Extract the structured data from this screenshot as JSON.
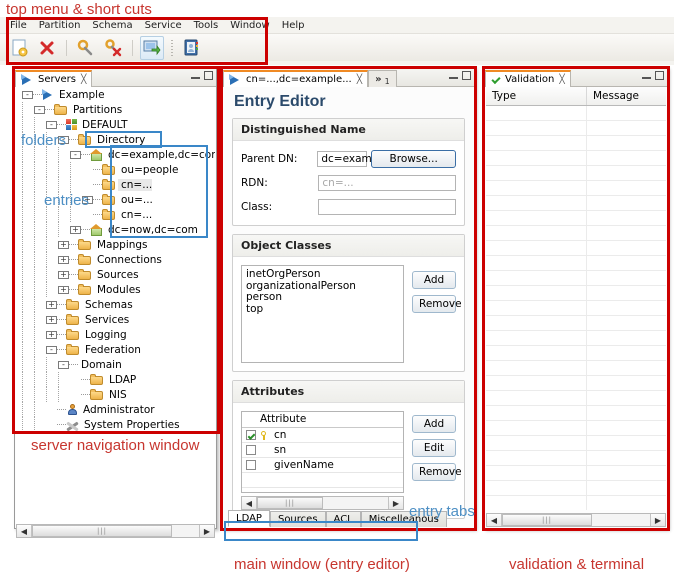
{
  "annotations": {
    "top": "top menu & short cuts",
    "folders": "folders",
    "entries": "entries",
    "server_nav": "server navigation window",
    "entry_tabs": "entry tabs",
    "main_window": "main window (entry editor)",
    "validation_terminal": "validation & terminal",
    "red": "#cc0000",
    "blue": "#3a87c8"
  },
  "menu": {
    "items": [
      "File",
      "Partition",
      "Schema",
      "Service",
      "Tools",
      "Window",
      "Help"
    ]
  },
  "toolbar": {
    "buttons": [
      {
        "name": "new-partition-icon",
        "title": "New"
      },
      {
        "name": "delete-icon",
        "title": "Delete"
      },
      {
        "name": "connect-icon",
        "title": "Connect"
      },
      {
        "name": "disconnect-icon",
        "title": "Disconnect"
      },
      {
        "name": "open-console-icon",
        "title": "Console"
      },
      {
        "name": "address-book-icon",
        "title": "Browse"
      }
    ]
  },
  "servers_view": {
    "tab_label": "Servers",
    "tree": [
      {
        "label": "Example",
        "depth": 0,
        "twist": "-",
        "icon": "server-icon"
      },
      {
        "label": "Partitions",
        "depth": 1,
        "twist": "-",
        "icon": "folder-icon"
      },
      {
        "label": "DEFAULT",
        "depth": 2,
        "twist": "-",
        "icon": "grid-icon"
      },
      {
        "label": "Directory",
        "depth": 3,
        "twist": "-",
        "icon": "folder-icon"
      },
      {
        "label": "dc=example,dc=com",
        "depth": 4,
        "twist": "-",
        "icon": "home-icon"
      },
      {
        "label": "ou=people",
        "depth": 5,
        "twist": "",
        "icon": "folder-icon"
      },
      {
        "label": "cn=...",
        "depth": 5,
        "twist": "",
        "icon": "folder-icon",
        "selected": true
      },
      {
        "label": "ou=...",
        "depth": 5,
        "twist": "+",
        "icon": "folder-icon"
      },
      {
        "label": "cn=...",
        "depth": 5,
        "twist": "",
        "icon": "folder-icon"
      },
      {
        "label": "dc=now,dc=com",
        "depth": 4,
        "twist": "+",
        "icon": "home-icon"
      },
      {
        "label": "Mappings",
        "depth": 3,
        "twist": "+",
        "icon": "folder-icon"
      },
      {
        "label": "Connections",
        "depth": 3,
        "twist": "+",
        "icon": "folder-icon"
      },
      {
        "label": "Sources",
        "depth": 3,
        "twist": "+",
        "icon": "folder-icon"
      },
      {
        "label": "Modules",
        "depth": 3,
        "twist": "+",
        "icon": "folder-icon"
      },
      {
        "label": "Schemas",
        "depth": 2,
        "twist": "+",
        "icon": "folder-icon"
      },
      {
        "label": "Services",
        "depth": 2,
        "twist": "+",
        "icon": "folder-icon"
      },
      {
        "label": "Logging",
        "depth": 2,
        "twist": "+",
        "icon": "folder-icon"
      },
      {
        "label": "Federation",
        "depth": 2,
        "twist": "-",
        "icon": "folder-icon"
      },
      {
        "label": "Domain",
        "depth": 3,
        "twist": "-",
        "icon": ""
      },
      {
        "label": "LDAP",
        "depth": 4,
        "twist": "",
        "icon": "folder-icon"
      },
      {
        "label": "NIS",
        "depth": 4,
        "twist": "",
        "icon": "folder-icon"
      },
      {
        "label": "Administrator",
        "depth": 2,
        "twist": "",
        "icon": "user-icon"
      },
      {
        "label": "System Properties",
        "depth": 2,
        "twist": "",
        "icon": "tools-icon"
      }
    ]
  },
  "editor_view": {
    "tab_label": "cn=...,dc=example...",
    "overflow_tab": "»",
    "overflow_count": "1",
    "title": "Entry Editor",
    "dn_section": {
      "header": "Distinguished Name",
      "parent_dn_label": "Parent DN:",
      "parent_dn_value": "dc=exam",
      "browse_label": "Browse...",
      "rdn_label": "RDN:",
      "rdn_placeholder": "cn=...",
      "class_label": "Class:",
      "class_value": ""
    },
    "object_classes": {
      "header": "Object Classes",
      "items": [
        "inetOrgPerson",
        "organizationalPerson",
        "person",
        "top"
      ],
      "add_label": "Add",
      "remove_label": "Remove"
    },
    "attributes": {
      "header": "Attributes",
      "column": "Attribute",
      "rows": [
        {
          "checked": true,
          "key": true,
          "name": "cn"
        },
        {
          "checked": false,
          "key": false,
          "name": "sn"
        },
        {
          "checked": false,
          "key": false,
          "name": "givenName"
        }
      ],
      "add_label": "Add",
      "edit_label": "Edit",
      "remove_label": "Remove"
    },
    "bottom_tabs": [
      {
        "label": "LDAP",
        "active": true
      },
      {
        "label": "Sources",
        "active": false
      },
      {
        "label": "ACL",
        "active": false
      },
      {
        "label": "Miscelleanous",
        "active": false
      }
    ]
  },
  "validation_view": {
    "tab_label": "Validation",
    "columns": [
      "Type",
      "Message"
    ],
    "row_count": 31
  }
}
